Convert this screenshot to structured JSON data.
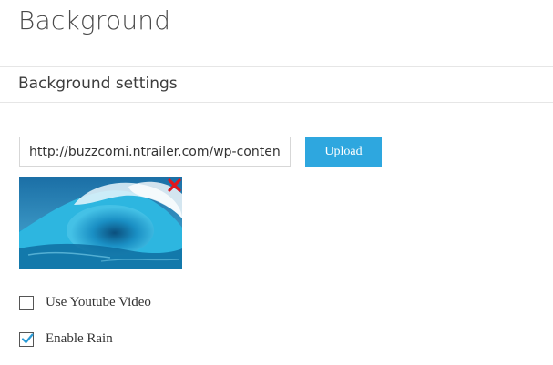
{
  "page": {
    "title": "Background"
  },
  "section": {
    "title": "Background settings"
  },
  "background_image": {
    "url_value": "http://buzzcomi.ntrailer.com/wp-content/uploads/wave.jpg",
    "upload_label": "Upload"
  },
  "options": {
    "youtube": {
      "label": "Use Youtube Video",
      "checked": false
    },
    "rain": {
      "label": "Enable Rain",
      "checked": true
    }
  },
  "colors": {
    "accent": "#2ea7df",
    "remove": "#e3161c",
    "check": "#2a9bd6"
  },
  "icons": {
    "remove": "close-icon",
    "check": "checkmark-icon"
  }
}
